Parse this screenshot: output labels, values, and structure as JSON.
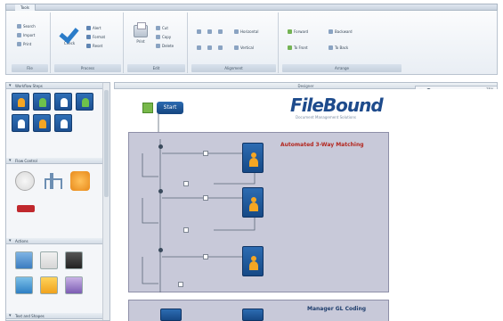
{
  "window": {
    "tab": "Tools"
  },
  "ribbon": {
    "groups": [
      {
        "label": "File",
        "items": [
          "Search",
          "Import",
          "Print"
        ]
      },
      {
        "label": "Process",
        "big": "Check",
        "items": [
          "Alert",
          "Format",
          "Reset"
        ]
      },
      {
        "label": "Edit",
        "big": "Print",
        "items": [
          "Cut",
          "Copy",
          "Delete"
        ]
      },
      {
        "label": "Alignment",
        "items": [
          "Horizontal",
          "Vertical"
        ]
      },
      {
        "label": "Arrange",
        "items": [
          "Forward",
          "Backward",
          "To Front",
          "To Back"
        ]
      }
    ]
  },
  "toolbox": {
    "sections": [
      "Workflow Steps",
      "Flow Control",
      "Actions",
      "Text and Shapes"
    ]
  },
  "designer": {
    "title": "Designer",
    "zoom": "75%"
  },
  "diagram": {
    "start_label": "Start",
    "logo": {
      "part1": "File",
      "part2": "Bound",
      "tagline": "Document Management Solutions"
    },
    "lanes": [
      {
        "title": "Automated 3-Way Matching"
      },
      {
        "title": "Manager GL Coding"
      }
    ]
  },
  "colors": {
    "lane": "#c8c9d9",
    "step": "#1c4f91",
    "lane_title": "#b3261e"
  }
}
